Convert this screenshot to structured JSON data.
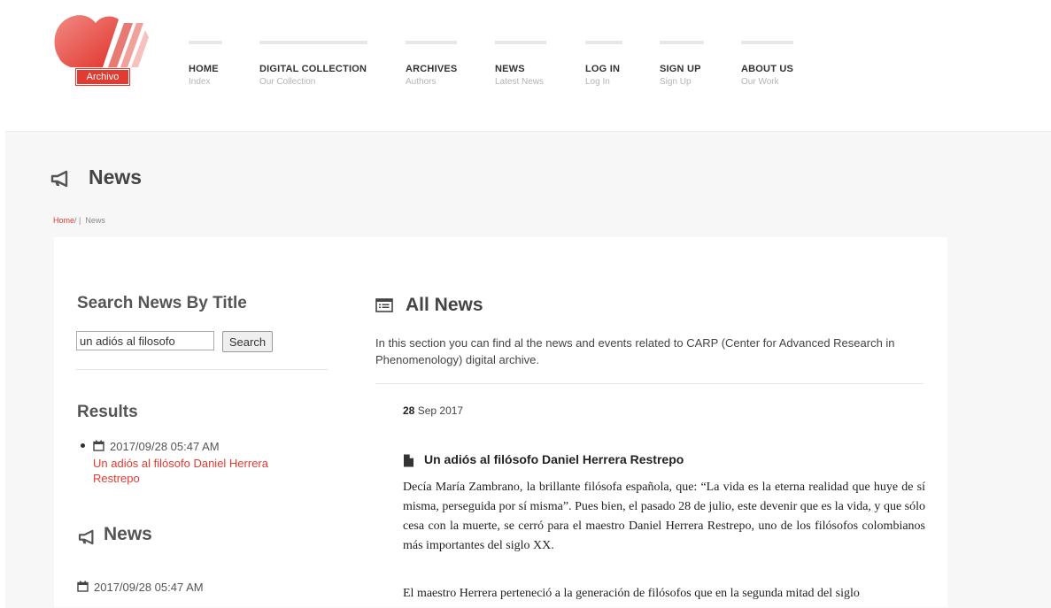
{
  "logo": {
    "label": "Archivo"
  },
  "nav": [
    {
      "title": "HOME",
      "subtitle": "Index"
    },
    {
      "title": "DIGITAL COLLECTION",
      "subtitle": "Our Collection"
    },
    {
      "title": "ARCHIVES",
      "subtitle": "Authors"
    },
    {
      "title": "NEWS",
      "subtitle": "Latest News"
    },
    {
      "title": "LOG IN",
      "subtitle": "Log In"
    },
    {
      "title": "SIGN UP",
      "subtitle": "Sign Up"
    },
    {
      "title": "ABOUT US",
      "subtitle": "Our Work"
    }
  ],
  "page": {
    "title": "News",
    "breadcrumb": {
      "home": "Home",
      "separator": "/  |",
      "current": "News"
    }
  },
  "sidebar": {
    "search_title": "Search News By Title",
    "search_value": "un adiós al filosofo",
    "search_button": "Search",
    "results_title": "Results",
    "results": [
      {
        "date": "2017/09/28 05:47 AM",
        "title": "Un adiós al filósofo Daniel Herrera Restrepo"
      }
    ],
    "news_title": "News",
    "news_items": [
      {
        "date": "2017/09/28 05:47 AM"
      }
    ]
  },
  "main": {
    "all_news_title": "All News",
    "description": "In this section you can find al the news and events related to CARP (Center for Advanced Research in Phenomenology) digital archive.",
    "article": {
      "day": "28",
      "month_year": "Sep 2017",
      "title": "Un adiós al filósofo Daniel Herrera Restrepo",
      "paragraphs": [
        "Decía María Zambrano, la brillante filósofa española, que: “La vida es la eterna realidad que huye de sí misma, perseguida por sí misma”. Pues bien, el pasado 28 de julio, este devenir que es la vida, y que sólo cesa con la muerte, se cerró para el maestro Daniel Herrera Restrepo, uno de los filósofos colombianos más importantes del siglo XX.",
        "El maestro Herrera perteneció a la generación de filósofos que en la segunda mitad del siglo"
      ]
    }
  },
  "colors": {
    "accent": "#e23b32",
    "nav_bar": "#e7e7e7",
    "band_bg": "#f7f7f7"
  },
  "icons": {
    "page_title": "bullhorn-icon",
    "side_news": "bullhorn-icon",
    "all_news": "list-alt-icon",
    "date": "calendar-icon",
    "article": "file-icon"
  }
}
